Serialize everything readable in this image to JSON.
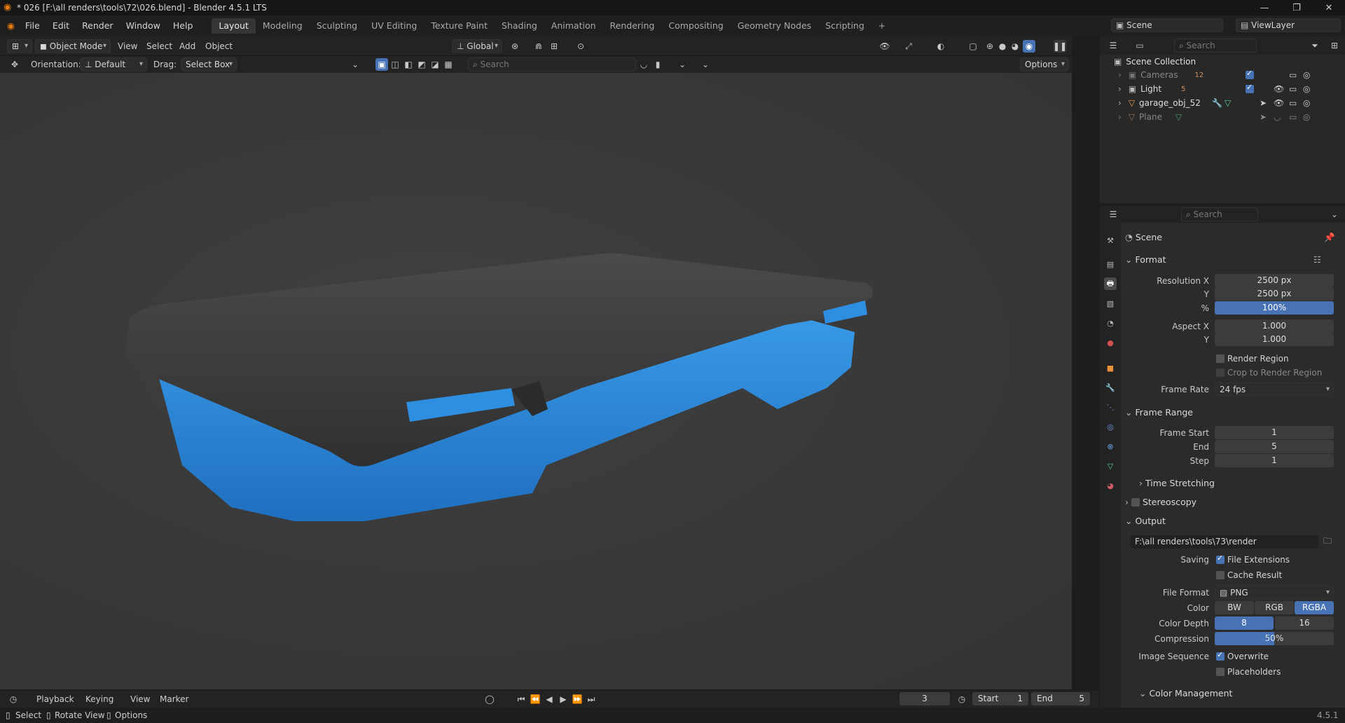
{
  "window": {
    "title": "* 026 [F:\\all renders\\tools\\72\\026.blend] - Blender 4.5.1 LTS",
    "minimize_icon": "minimize-icon",
    "restore_icon": "restore-icon",
    "close_icon": "close-icon"
  },
  "menus": [
    "File",
    "Edit",
    "Render",
    "Window",
    "Help"
  ],
  "workspaces": [
    "Layout",
    "Modeling",
    "Sculpting",
    "UV Editing",
    "Texture Paint",
    "Shading",
    "Animation",
    "Rendering",
    "Compositing",
    "Geometry Nodes",
    "Scripting",
    "+"
  ],
  "scene_selector": {
    "label": "Scene",
    "view_layer": "ViewLayer"
  },
  "viewport_header": {
    "mode": "Object Mode",
    "menus": [
      "View",
      "Select",
      "Add",
      "Object"
    ],
    "transform_orientation": "Global",
    "search_placeholder": "Search",
    "options": "Options"
  },
  "tool_settings": {
    "orientation_label": "Orientation:",
    "orientation_value": "Default",
    "drag_label": "Drag:",
    "drag_value": "Select Box"
  },
  "outliner": {
    "search_placeholder": "Search",
    "root": "Scene Collection",
    "items": [
      {
        "name": "Cameras",
        "badge": "12",
        "dim": true
      },
      {
        "name": "Light",
        "badge": "5",
        "dim": false
      },
      {
        "name": "garage_obj_52",
        "badge": "",
        "dim": false
      },
      {
        "name": "Plane",
        "badge": "",
        "dim": true
      }
    ]
  },
  "properties": {
    "search_placeholder": "Search",
    "context": "Scene",
    "format": {
      "header": "Format",
      "resolution_x_label": "Resolution X",
      "resolution_x": "2500 px",
      "y_label": "Y",
      "resolution_y": "2500 px",
      "pct_label": "%",
      "resolution_pct": "100%",
      "aspect_x_label": "Aspect X",
      "aspect_x": "1.000",
      "aspect_y_label": "Y",
      "aspect_y": "1.000",
      "render_region": "Render Region",
      "crop_region": "Crop to Render Region",
      "frame_rate_label": "Frame Rate",
      "frame_rate": "24 fps"
    },
    "frame_range": {
      "header": "Frame Range",
      "start_label": "Frame Start",
      "start": "1",
      "end_label": "End",
      "end": "5",
      "step_label": "Step",
      "step": "1",
      "time_stretching": "Time Stretching"
    },
    "stereoscopy": "Stereoscopy",
    "output": {
      "header": "Output",
      "path": "F:\\all renders\\tools\\73\\render",
      "saving_label": "Saving",
      "file_extensions": "File Extensions",
      "cache_result": "Cache Result",
      "file_format_label": "File Format",
      "file_format": "PNG",
      "color_label": "Color",
      "color_options": [
        "BW",
        "RGB",
        "RGBA"
      ],
      "color_selected": "RGBA",
      "depth_label": "Color Depth",
      "depth_options": [
        "8",
        "16"
      ],
      "depth_selected": "8",
      "compression_label": "Compression",
      "compression": "50%",
      "compression_value": 0.5,
      "image_sequence_label": "Image Sequence",
      "overwrite": "Overwrite",
      "placeholders": "Placeholders"
    },
    "color_management": "Color Management"
  },
  "timeline": {
    "menus": [
      "Playback",
      "Keying",
      "View",
      "Marker"
    ],
    "current_frame": "3",
    "start_label": "Start",
    "start": "1",
    "end_label": "End",
    "end": "5"
  },
  "status": {
    "select": "Select",
    "rotate": "Rotate View",
    "options": "Options",
    "version": "4.5.1"
  },
  "colors": {
    "accent": "#4772b3",
    "case_blue": "#2f86d6",
    "case_dark": "#3a3a3a"
  }
}
